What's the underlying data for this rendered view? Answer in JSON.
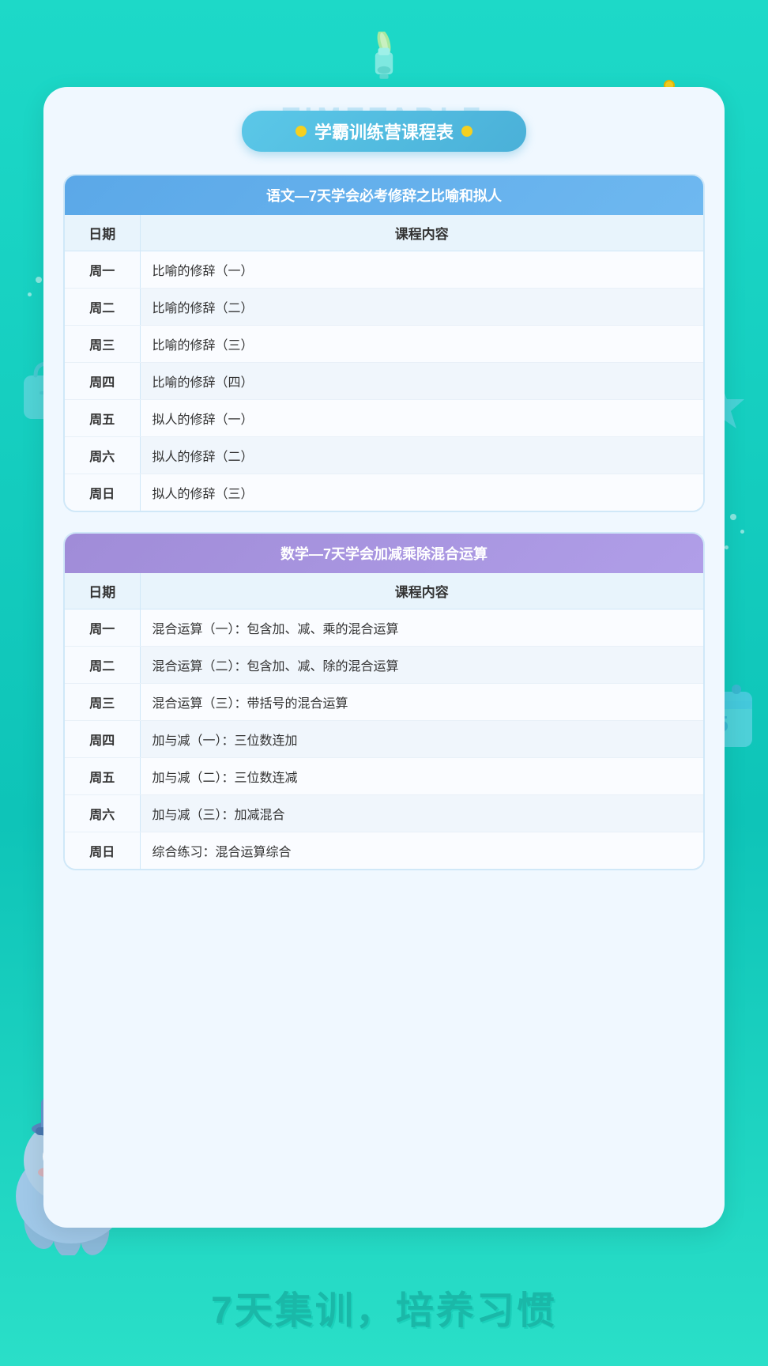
{
  "background": {
    "color_top": "#1dd9c8",
    "color_bottom": "#2adfc8"
  },
  "watermark": "TIMETABLE",
  "title_badge": {
    "text": "学霸训练营课程表",
    "dot_color": "#f5d020"
  },
  "chinese_section": {
    "header": "语文—7天学会必考修辞之比喻和拟人",
    "col_day": "日期",
    "col_content": "课程内容",
    "rows": [
      {
        "day": "周一",
        "content": "比喻的修辞（一）"
      },
      {
        "day": "周二",
        "content": "比喻的修辞（二）"
      },
      {
        "day": "周三",
        "content": "比喻的修辞（三）"
      },
      {
        "day": "周四",
        "content": "比喻的修辞（四）"
      },
      {
        "day": "周五",
        "content": "拟人的修辞（一）"
      },
      {
        "day": "周六",
        "content": "拟人的修辞（二）"
      },
      {
        "day": "周日",
        "content": "拟人的修辞（三）"
      }
    ]
  },
  "math_section": {
    "header": "数学—7天学会加减乘除混合运算",
    "col_day": "日期",
    "col_content": "课程内容",
    "rows": [
      {
        "day": "周一",
        "content": "混合运算（一）：包含加、减、乘的混合运算"
      },
      {
        "day": "周二",
        "content": "混合运算（二）：包含加、减、除的混合运算"
      },
      {
        "day": "周三",
        "content": "混合运算（三）：带括号的混合运算"
      },
      {
        "day": "周四",
        "content": "加与减（一）：三位数连加"
      },
      {
        "day": "周五",
        "content": "加与减（二）：三位数连减"
      },
      {
        "day": "周六",
        "content": "加与减（三）：加减混合"
      },
      {
        "day": "周日",
        "content": "综合练习：混合运算综合"
      }
    ]
  },
  "bottom_text": "7天集训，培养习惯"
}
